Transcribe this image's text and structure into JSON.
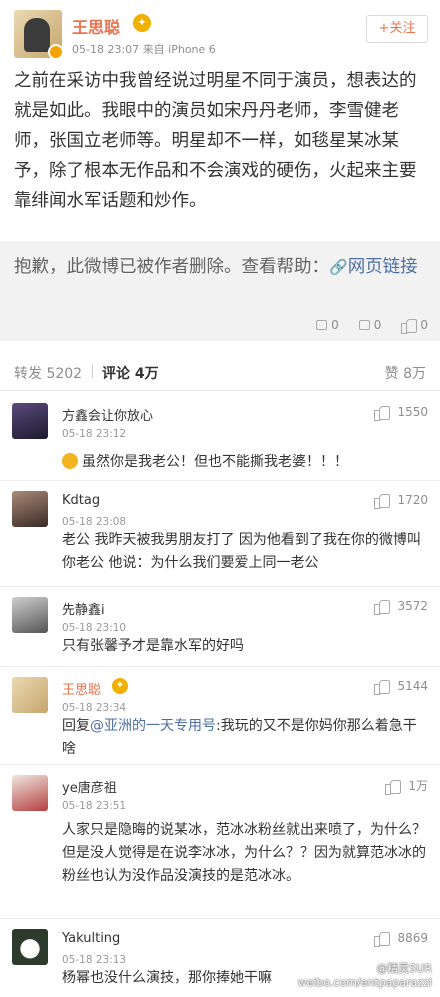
{
  "post": {
    "author": "王思聪",
    "vip_badge": "✦",
    "meta": "05-18 23:07  来自 iPhone 6",
    "follow_label": "+关注",
    "body": "之前在采访中我曾经说过明星不同于演员，想表达的就是如此。我眼中的演员如宋丹丹老师，李雪健老师，张国立老师等。明星却不一样，如毯星某冰某予，除了根本无作品和不会演戏的硬伤，火起来主要靠绯闻水军话题和炒作。"
  },
  "retweet": {
    "deleted_text": "抱歉，此微博已被作者删除。查看帮助：",
    "link_icon": "🔗",
    "link_text": "网页链接",
    "stats": {
      "repost": "0",
      "comment": "0",
      "like": "0"
    }
  },
  "tabs": {
    "repost": "转发 5202",
    "comment": "评论 4万",
    "like": "赞 8万"
  },
  "comments": [
    {
      "name": "方鑫会让你放心",
      "time": "05-18 23:12",
      "likes": "1550",
      "text": "虽然你是我老公！但也不能撕我老婆！！！"
    },
    {
      "name": "Kdtag",
      "time": "05-18 23:08",
      "likes": "1720",
      "text": "老公 我昨天被我男朋友打了 因为他看到了我在你的微博叫你老公 他说：为什么我们要爱上同一老公"
    },
    {
      "name": "先静鑫i",
      "time": "05-18 23:10",
      "likes": "3572",
      "text": "只有张馨予才是靠水军的好吗"
    },
    {
      "name": "王思聪",
      "time": "05-18 23:34",
      "likes": "5144",
      "reply_prefix": "回复",
      "mention": "@亚洲的一天专用号",
      "text": ":我玩的又不是你妈你那么着急干啥"
    },
    {
      "name": "ye唐彦祖",
      "time": "05-18 23:51",
      "likes": "1万",
      "text": "人家只是隐晦的说某冰，范冰冰粉丝就出来喷了，为什么？但是没人觉得是在说李冰冰，为什么？？因为就算范冰冰的粉丝也认为没作品没演技的是范冰冰。"
    },
    {
      "name": "Yakulting",
      "time": "05-18 23:13",
      "likes": "8869",
      "text": "杨幂也没什么演技，那你捧她干嘛"
    }
  ],
  "watermark": {
    "line1": "@精灵SUR",
    "line2": "weibo.com/entpaparazzi"
  },
  "colors": {
    "accent": "#eb7350",
    "link": "#4e6fa3",
    "gray_bg": "#f2f2f2"
  }
}
